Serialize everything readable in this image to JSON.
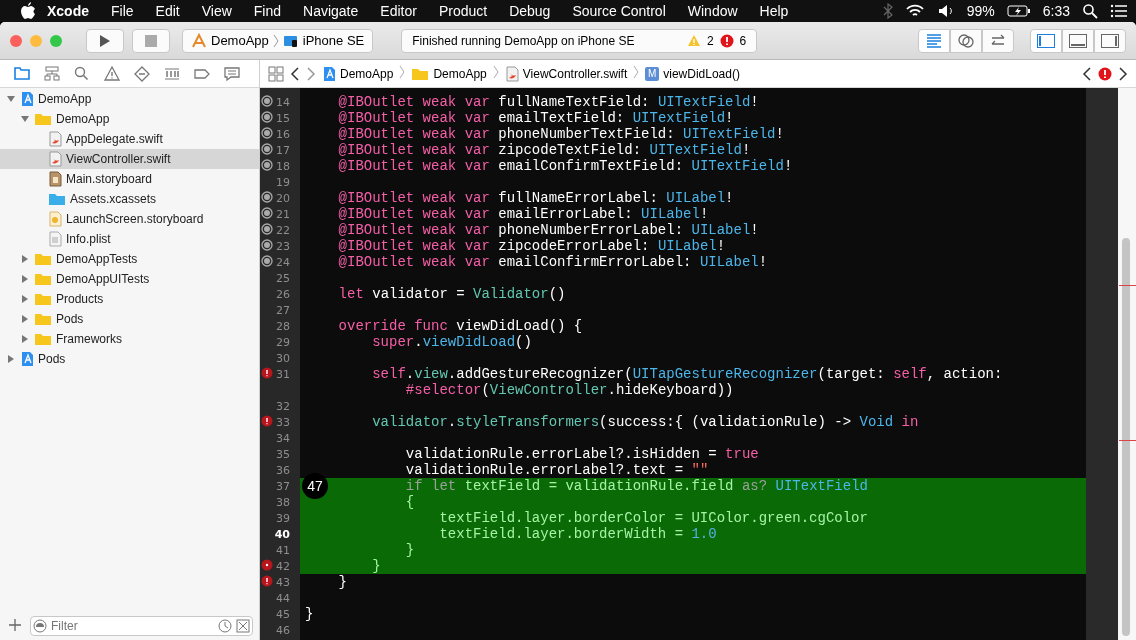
{
  "menu_bar": {
    "app": "Xcode",
    "menus": [
      "File",
      "Edit",
      "View",
      "Find",
      "Navigate",
      "Editor",
      "Product",
      "Debug",
      "Source Control",
      "Window",
      "Help"
    ],
    "battery": "99%",
    "clock": "6:33"
  },
  "toolbar": {
    "scheme": "DemoApp",
    "device": "iPhone SE",
    "activity": "Finished running DemoApp on iPhone SE",
    "warnings": "2",
    "errors": "6",
    "editor_modes": [
      {
        "kind": "standard",
        "selected": true
      },
      {
        "kind": "assistant",
        "selected": false
      },
      {
        "kind": "version",
        "selected": false
      }
    ],
    "panels": [
      {
        "kind": "navigator",
        "selected": true
      },
      {
        "kind": "debug",
        "selected": false
      },
      {
        "kind": "utilities",
        "selected": false
      }
    ]
  },
  "navigator_tabs": [
    {
      "kind": "project",
      "selected": true
    },
    {
      "kind": "source-control",
      "selected": false
    },
    {
      "kind": "search",
      "selected": false
    },
    {
      "kind": "issues",
      "selected": false
    },
    {
      "kind": "tests",
      "selected": false
    },
    {
      "kind": "debug",
      "selected": false
    },
    {
      "kind": "breakpoints",
      "selected": false
    },
    {
      "kind": "reports",
      "selected": false
    }
  ],
  "tree": [
    {
      "label": "DemoApp",
      "kind": "project",
      "expanded": true,
      "selected": false,
      "children": [
        {
          "label": "DemoApp",
          "kind": "folder",
          "expanded": true,
          "selected": false,
          "children": [
            {
              "label": "AppDelegate.swift",
              "kind": "swift",
              "selected": false
            },
            {
              "label": "ViewController.swift",
              "kind": "swift",
              "selected": true
            },
            {
              "label": "Main.storyboard",
              "kind": "storyboard",
              "selected": false
            },
            {
              "label": "Assets.xcassets",
              "kind": "assets",
              "selected": false
            },
            {
              "label": "LaunchScreen.storyboard",
              "kind": "launch",
              "selected": false
            },
            {
              "label": "Info.plist",
              "kind": "plist",
              "selected": false
            }
          ]
        },
        {
          "label": "DemoAppTests",
          "kind": "folder",
          "expanded": false,
          "selected": false
        },
        {
          "label": "DemoAppUITests",
          "kind": "folder",
          "expanded": false,
          "selected": false
        },
        {
          "label": "Products",
          "kind": "folder",
          "expanded": false,
          "selected": false
        },
        {
          "label": "Pods",
          "kind": "folder",
          "expanded": false,
          "selected": false
        },
        {
          "label": "Frameworks",
          "kind": "folder",
          "expanded": false,
          "selected": false
        }
      ]
    },
    {
      "label": "Pods",
      "kind": "project",
      "expanded": false,
      "selected": false
    }
  ],
  "filter": {
    "placeholder": "Filter"
  },
  "jump_bar": [
    {
      "label": "DemoApp",
      "kind": "project"
    },
    {
      "label": "DemoApp",
      "kind": "folder"
    },
    {
      "label": "ViewController.swift",
      "kind": "swift"
    },
    {
      "label": "viewDidLoad()",
      "kind": "method",
      "badge": "M"
    }
  ],
  "editor": {
    "step_badge": "47",
    "lines": [
      {
        "number": "14",
        "kind": "outlet",
        "highlighted": false,
        "current": false,
        "tokens": [
          {
            "kind": "k",
            "text": "    @IBOutlet weak var"
          },
          {
            "kind": "n",
            "text": " fullNameTextField: "
          },
          {
            "kind": "t",
            "text": "UITextField"
          },
          {
            "kind": "n",
            "text": "!"
          }
        ]
      },
      {
        "number": "15",
        "kind": "outlet",
        "highlighted": false,
        "current": false,
        "tokens": [
          {
            "kind": "k",
            "text": "    @IBOutlet weak var"
          },
          {
            "kind": "n",
            "text": " emailTextField: "
          },
          {
            "kind": "t",
            "text": "UITextField"
          },
          {
            "kind": "n",
            "text": "!"
          }
        ]
      },
      {
        "number": "16",
        "kind": "outlet",
        "highlighted": false,
        "current": false,
        "tokens": [
          {
            "kind": "k",
            "text": "    @IBOutlet weak var"
          },
          {
            "kind": "n",
            "text": " phoneNumberTextField: "
          },
          {
            "kind": "t",
            "text": "UITextField"
          },
          {
            "kind": "n",
            "text": "!"
          }
        ]
      },
      {
        "number": "17",
        "kind": "outlet",
        "highlighted": false,
        "current": false,
        "tokens": [
          {
            "kind": "k",
            "text": "    @IBOutlet weak var"
          },
          {
            "kind": "n",
            "text": " zipcodeTextField: "
          },
          {
            "kind": "t",
            "text": "UITextField"
          },
          {
            "kind": "n",
            "text": "!"
          }
        ]
      },
      {
        "number": "18",
        "kind": "outlet",
        "highlighted": false,
        "current": false,
        "tokens": [
          {
            "kind": "k",
            "text": "    @IBOutlet weak var"
          },
          {
            "kind": "n",
            "text": " emailConfirmTextField: "
          },
          {
            "kind": "t",
            "text": "UITextField"
          },
          {
            "kind": "n",
            "text": "!"
          }
        ]
      },
      {
        "number": "19",
        "kind": "plain",
        "highlighted": false,
        "current": false
      },
      {
        "number": "20",
        "kind": "outlet",
        "highlighted": false,
        "current": false,
        "tokens": [
          {
            "kind": "k",
            "text": "    @IBOutlet weak var"
          },
          {
            "kind": "n",
            "text": " fullNameErrorLabel: "
          },
          {
            "kind": "t",
            "text": "UILabel"
          },
          {
            "kind": "n",
            "text": "!"
          }
        ]
      },
      {
        "number": "21",
        "kind": "outlet",
        "highlighted": false,
        "current": false,
        "tokens": [
          {
            "kind": "k",
            "text": "    @IBOutlet weak var"
          },
          {
            "kind": "n",
            "text": " emailErrorLabel: "
          },
          {
            "kind": "t",
            "text": "UILabel"
          },
          {
            "kind": "n",
            "text": "!"
          }
        ]
      },
      {
        "number": "22",
        "kind": "outlet",
        "highlighted": false,
        "current": false,
        "tokens": [
          {
            "kind": "k",
            "text": "    @IBOutlet weak var"
          },
          {
            "kind": "n",
            "text": " phoneNumberErrorLabel: "
          },
          {
            "kind": "t",
            "text": "UILabel"
          },
          {
            "kind": "n",
            "text": "!"
          }
        ]
      },
      {
        "number": "23",
        "kind": "outlet",
        "highlighted": false,
        "current": false,
        "tokens": [
          {
            "kind": "k",
            "text": "    @IBOutlet weak var"
          },
          {
            "kind": "n",
            "text": " zipcodeErrorLabel: "
          },
          {
            "kind": "t",
            "text": "UILabel"
          },
          {
            "kind": "n",
            "text": "!"
          }
        ]
      },
      {
        "number": "24",
        "kind": "outlet",
        "highlighted": false,
        "current": false,
        "tokens": [
          {
            "kind": "k",
            "text": "    @IBOutlet weak var"
          },
          {
            "kind": "n",
            "text": " emailConfirmErrorLabel: "
          },
          {
            "kind": "t",
            "text": "UILabel"
          },
          {
            "kind": "n",
            "text": "!"
          }
        ]
      },
      {
        "number": "25",
        "kind": "plain",
        "highlighted": false,
        "current": false
      },
      {
        "number": "26",
        "kind": "plain",
        "highlighted": false,
        "current": false,
        "tokens": [
          {
            "kind": "k",
            "text": "    let"
          },
          {
            "kind": "n",
            "text": " validator = "
          },
          {
            "kind": "p",
            "text": "Validator"
          },
          {
            "kind": "n",
            "text": "()"
          }
        ]
      },
      {
        "number": "27",
        "kind": "plain",
        "highlighted": false,
        "current": false
      },
      {
        "number": "28",
        "kind": "plain",
        "highlighted": false,
        "current": false,
        "tokens": [
          {
            "kind": "k",
            "text": "    override func"
          },
          {
            "kind": "n",
            "text": " viewDidLoad() {"
          }
        ]
      },
      {
        "number": "29",
        "kind": "plain",
        "highlighted": false,
        "current": false,
        "tokens": [
          {
            "kind": "k",
            "text": "        super"
          },
          {
            "kind": "n",
            "text": "."
          },
          {
            "kind": "t",
            "text": "viewDidLoad"
          },
          {
            "kind": "n",
            "text": "()"
          }
        ]
      },
      {
        "number": "30",
        "kind": "plain",
        "highlighted": false,
        "current": false
      },
      {
        "number": "31",
        "kind": "error",
        "highlighted": false,
        "current": false,
        "tokens": [
          {
            "kind": "k",
            "text": "        self"
          },
          {
            "kind": "n",
            "text": "."
          },
          {
            "kind": "p",
            "text": "view"
          },
          {
            "kind": "n",
            "text": ".addGestureRecognizer("
          },
          {
            "kind": "t",
            "text": "UITapGestureRecognizer"
          },
          {
            "kind": "n",
            "text": "(target: "
          },
          {
            "kind": "k",
            "text": "self"
          },
          {
            "kind": "n",
            "text": ", action:"
          }
        ]
      },
      {
        "kind": "plain",
        "highlighted": false,
        "tokens": [
          {
            "kind": "k",
            "text": "            #selector"
          },
          {
            "kind": "n",
            "text": "("
          },
          {
            "kind": "p",
            "text": "ViewController"
          },
          {
            "kind": "n",
            "text": ".hideKeyboard))"
          }
        ]
      },
      {
        "number": "32",
        "kind": "plain",
        "highlighted": false,
        "current": false
      },
      {
        "number": "33",
        "kind": "error",
        "highlighted": false,
        "current": false,
        "tokens": [
          {
            "kind": "p",
            "text": "        validator"
          },
          {
            "kind": "n",
            "text": "."
          },
          {
            "kind": "p",
            "text": "styleTransformers"
          },
          {
            "kind": "n",
            "text": "(success:{ (validationRule) -> "
          },
          {
            "kind": "t",
            "text": "Void"
          },
          {
            "kind": "k",
            "text": " in"
          }
        ]
      },
      {
        "number": "34",
        "kind": "plain",
        "highlighted": false,
        "current": false
      },
      {
        "number": "35",
        "kind": "plain",
        "highlighted": false,
        "current": false,
        "tokens": [
          {
            "kind": "n",
            "text": "            validationRule.errorLabel?.isHidden = "
          },
          {
            "kind": "k",
            "text": "true"
          }
        ]
      },
      {
        "number": "36",
        "kind": "plain",
        "highlighted": false,
        "current": false,
        "tokens": [
          {
            "kind": "n",
            "text": "            validationRule.errorLabel?.text = "
          },
          {
            "kind": "s",
            "text": "\"\""
          }
        ]
      },
      {
        "number": "37",
        "kind": "plain",
        "highlighted": true,
        "current": false,
        "tokens": [
          {
            "kind": "d",
            "text": "            if let"
          },
          {
            "kind": "n",
            "text": " textField = validationRule.field "
          },
          {
            "kind": "d",
            "text": "as?"
          },
          {
            "kind": "t",
            "text": " UITextField"
          }
        ]
      },
      {
        "number": "38",
        "kind": "plain",
        "highlighted": true,
        "current": false,
        "tokens": [
          {
            "kind": "n",
            "text": "            {"
          }
        ]
      },
      {
        "number": "39",
        "kind": "plain",
        "highlighted": true,
        "current": false,
        "tokens": [
          {
            "kind": "n",
            "text": "                textField.layer.borderColor = UIColor.green.cgColor"
          }
        ]
      },
      {
        "number": "40",
        "kind": "plain",
        "highlighted": true,
        "current": true,
        "tokens": [
          {
            "kind": "n",
            "text": "                textField.layer.borderWidth = "
          },
          {
            "kind": "m",
            "text": "1.0"
          }
        ]
      },
      {
        "number": "41",
        "kind": "plain",
        "highlighted": true,
        "current": false,
        "tokens": [
          {
            "kind": "n",
            "text": "            }"
          }
        ]
      },
      {
        "number": "42",
        "kind": "issue",
        "highlighted": true,
        "current": false,
        "tokens": [
          {
            "kind": "n",
            "text": "        }"
          }
        ]
      },
      {
        "number": "43",
        "kind": "error",
        "highlighted": false,
        "current": false,
        "tokens": [
          {
            "kind": "n",
            "text": "    }"
          }
        ]
      },
      {
        "number": "44",
        "kind": "plain",
        "highlighted": false,
        "current": false
      },
      {
        "number": "45",
        "kind": "plain",
        "highlighted": false,
        "current": false,
        "tokens": [
          {
            "kind": "n",
            "text": "}"
          }
        ]
      },
      {
        "number": "46",
        "kind": "plain",
        "highlighted": false,
        "current": false
      }
    ]
  }
}
